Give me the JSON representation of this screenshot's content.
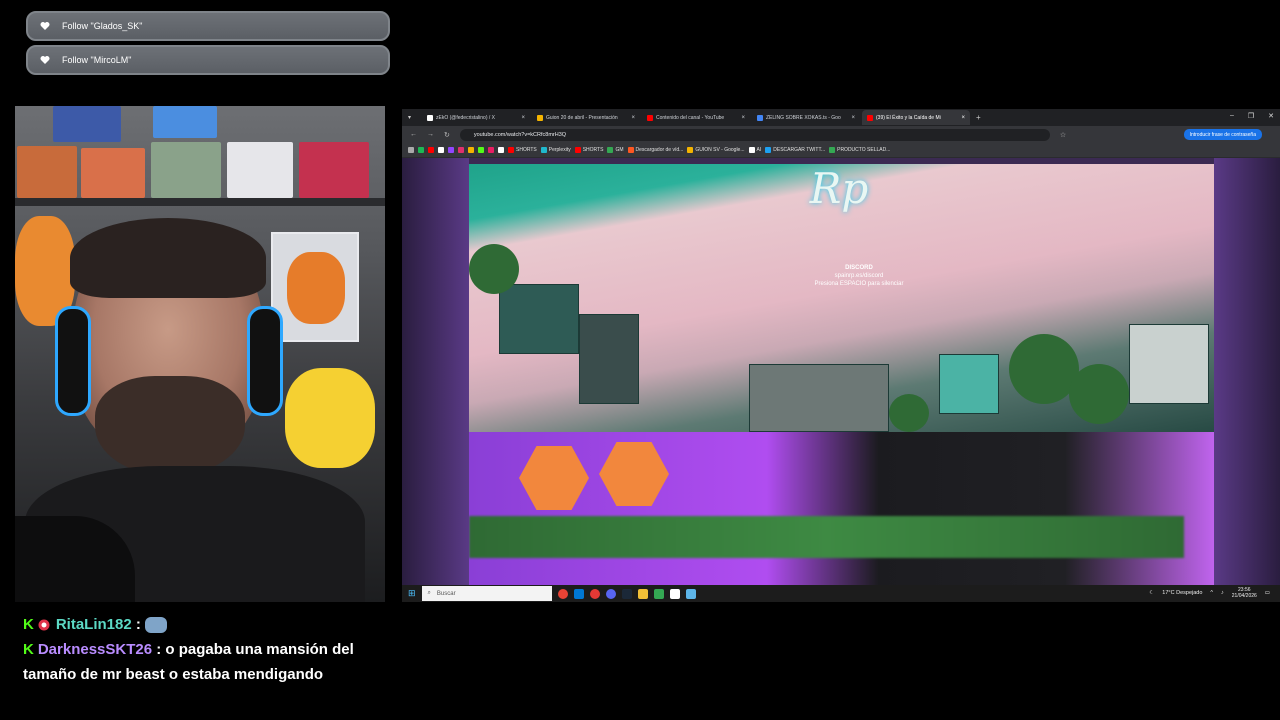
{
  "alerts": [
    {
      "text": "Follow \"Glados_SK\""
    },
    {
      "text": "Follow \"MircoLM\""
    }
  ],
  "chat": [
    {
      "user": "RitaLin182",
      "separator": ":",
      "message": ""
    },
    {
      "user": "DarknessSKT26",
      "separator": ":",
      "message": "o pagaba una mansión del tamaño de mr beast o estaba mendigando"
    }
  ],
  "browser": {
    "tabs": [
      {
        "label": "zEkO (@fedecristalino) / X",
        "color": "#000000",
        "active": false
      },
      {
        "label": "Guion 20 de abril - Presentación",
        "color": "#f4b400",
        "active": false
      },
      {
        "label": "Contenido del canal - YouTube",
        "color": "#ff0000",
        "active": false
      },
      {
        "label": "ZELING SOBRE XOKAS.ts - Goo",
        "color": "#4285f4",
        "active": false
      },
      {
        "label": "(39) El Éxito y la Caída de Mi",
        "color": "#ff0000",
        "active": true
      }
    ],
    "url": "youtube.com/watch?v=kCRfc8mrH3Q",
    "password_button": "Introducir frase de contraseña",
    "bookmarks": [
      "SHORTS",
      "Perplexity",
      "SHORTS",
      "GM",
      "Descargador de víd...",
      "GUION SV - Google...",
      "AI",
      "DESCARGAR TWITT...",
      "PRODUCTO SELLAD..."
    ]
  },
  "video": {
    "logo_text": "Rp",
    "overlay_title": "DISCORD",
    "overlay_line1": "spainrp.es/discord",
    "overlay_line2": "Presiona ESPACIO para silenciar"
  },
  "taskbar": {
    "search_placeholder": "Buscar",
    "weather": "17°C  Despejado",
    "time": "23:56",
    "date": "21/04/2026"
  }
}
